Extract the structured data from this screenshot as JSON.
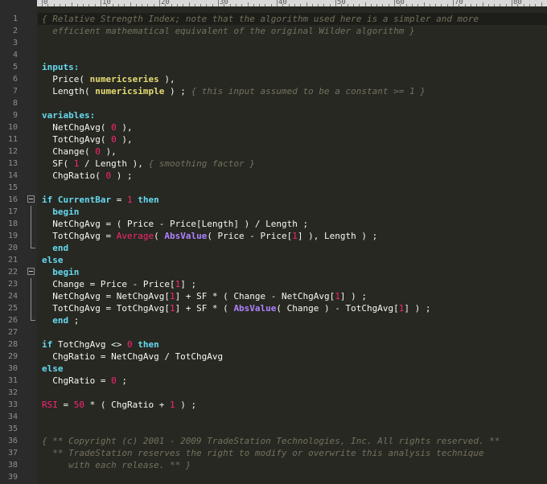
{
  "colors": {
    "background": "#272822",
    "comment": "#75715e",
    "keyword": "#66d9ef",
    "type": "#e6db74",
    "function": "#f92672",
    "builtin": "#ae81ff",
    "number": "#f92672",
    "text": "#f8f8f2"
  },
  "ruler": {
    "labels": [
      "0",
      "10",
      "20",
      "30",
      "40",
      "50",
      "60",
      "70",
      "80",
      "9"
    ]
  },
  "current_line": 1,
  "fold": {
    "open": [
      16,
      22
    ],
    "line": [
      17,
      18,
      19,
      23,
      24,
      25
    ],
    "end": [
      20,
      26
    ]
  },
  "lines": [
    [
      [
        "cmt",
        "{ Relative Strength Index; note that the algorithm used here is a simpler and more"
      ]
    ],
    [
      [
        "cmt",
        "  efficient mathematical equivalent of the original Wilder algorithm }"
      ]
    ],
    [],
    [],
    [
      [
        "kw",
        "inputs:"
      ]
    ],
    [
      [
        "txt",
        "  Price( "
      ],
      [
        "typ",
        "numericseries"
      ],
      [
        "txt",
        " ),"
      ]
    ],
    [
      [
        "txt",
        "  Length( "
      ],
      [
        "typ",
        "numericsimple"
      ],
      [
        "txt",
        " ) ; "
      ],
      [
        "cmt",
        "{ this input assumed to be a constant >= 1 }"
      ]
    ],
    [],
    [
      [
        "kw",
        "variables:"
      ]
    ],
    [
      [
        "txt",
        "  NetChgAvg( "
      ],
      [
        "num",
        "0"
      ],
      [
        "txt",
        " ),"
      ]
    ],
    [
      [
        "txt",
        "  TotChgAvg( "
      ],
      [
        "num",
        "0"
      ],
      [
        "txt",
        " ),"
      ]
    ],
    [
      [
        "txt",
        "  Change( "
      ],
      [
        "num",
        "0"
      ],
      [
        "txt",
        " ),"
      ]
    ],
    [
      [
        "txt",
        "  SF( "
      ],
      [
        "num",
        "1"
      ],
      [
        "txt",
        " / Length ), "
      ],
      [
        "cmt",
        "{ smoothing factor }"
      ]
    ],
    [
      [
        "txt",
        "  ChgRatio( "
      ],
      [
        "num",
        "0"
      ],
      [
        "txt",
        " ) ;"
      ]
    ],
    [],
    [
      [
        "kw",
        "if CurrentBar"
      ],
      [
        "txt",
        " = "
      ],
      [
        "num",
        "1"
      ],
      [
        "kw",
        " then"
      ]
    ],
    [
      [
        "kw",
        "  begin"
      ]
    ],
    [
      [
        "txt",
        "  NetChgAvg = ( Price - Price[Length] ) / Length ;"
      ]
    ],
    [
      [
        "txt",
        "  TotChgAvg = "
      ],
      [
        "fn",
        "Average"
      ],
      [
        "txt",
        "( "
      ],
      [
        "fnp",
        "AbsValue"
      ],
      [
        "txt",
        "( Price - Price["
      ],
      [
        "num",
        "1"
      ],
      [
        "txt",
        "] ), Length ) ;"
      ]
    ],
    [
      [
        "kw",
        "  end"
      ]
    ],
    [
      [
        "kw",
        "else"
      ]
    ],
    [
      [
        "kw",
        "  begin"
      ]
    ],
    [
      [
        "txt",
        "  Change = Price - Price["
      ],
      [
        "num",
        "1"
      ],
      [
        "txt",
        "] ;"
      ]
    ],
    [
      [
        "txt",
        "  NetChgAvg = NetChgAvg["
      ],
      [
        "num",
        "1"
      ],
      [
        "txt",
        "] + SF * ( Change - NetChgAvg["
      ],
      [
        "num",
        "1"
      ],
      [
        "txt",
        "] ) ;"
      ]
    ],
    [
      [
        "txt",
        "  TotChgAvg = TotChgAvg["
      ],
      [
        "num",
        "1"
      ],
      [
        "txt",
        "] + SF * ( "
      ],
      [
        "fnp",
        "AbsValue"
      ],
      [
        "txt",
        "( Change ) - TotChgAvg["
      ],
      [
        "num",
        "1"
      ],
      [
        "txt",
        "] ) ;"
      ]
    ],
    [
      [
        "kw",
        "  end"
      ],
      [
        "txt",
        " ;"
      ]
    ],
    [],
    [
      [
        "kw",
        "if"
      ],
      [
        "txt",
        " TotChgAvg <> "
      ],
      [
        "num",
        "0"
      ],
      [
        "kw",
        " then"
      ]
    ],
    [
      [
        "txt",
        "  ChgRatio = NetChgAvg / TotChgAvg"
      ]
    ],
    [
      [
        "kw",
        "else"
      ]
    ],
    [
      [
        "txt",
        "  ChgRatio = "
      ],
      [
        "num",
        "0"
      ],
      [
        "txt",
        " ;"
      ]
    ],
    [],
    [
      [
        "fn",
        "RSI"
      ],
      [
        "txt",
        " = "
      ],
      [
        "num",
        "50"
      ],
      [
        "txt",
        " * ( ChgRatio + "
      ],
      [
        "num",
        "1"
      ],
      [
        "txt",
        " ) ;"
      ]
    ],
    [],
    [],
    [
      [
        "cmt",
        "{ ** Copyright (c) 2001 - 2009 TradeStation Technologies, Inc. All rights reserved. **"
      ]
    ],
    [
      [
        "cmt",
        "  ** TradeStation reserves the right to modify or overwrite this analysis technique"
      ]
    ],
    [
      [
        "cmt",
        "     with each release. ** }"
      ]
    ],
    []
  ]
}
